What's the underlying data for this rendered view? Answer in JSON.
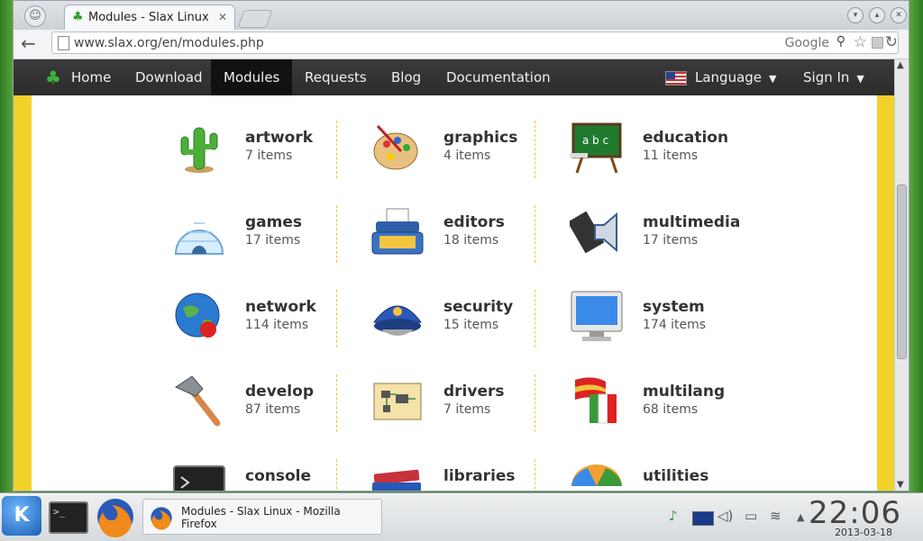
{
  "window": {
    "tab_title": "Modules - Slax Linux"
  },
  "toolbar": {
    "url": "www.slax.org/en/modules.php",
    "search_engine": "Google"
  },
  "nav": {
    "items": [
      "Home",
      "Download",
      "Modules",
      "Requests",
      "Blog",
      "Documentation"
    ],
    "active": "Modules",
    "language": "Language",
    "signin": "Sign In"
  },
  "categories": [
    {
      "name": "artwork",
      "count": "7 items",
      "icon": "cactus-icon"
    },
    {
      "name": "graphics",
      "count": "4 items",
      "icon": "palette-icon"
    },
    {
      "name": "education",
      "count": "11 items",
      "icon": "chalkboard-icon"
    },
    {
      "name": "games",
      "count": "17 items",
      "icon": "igloo-icon"
    },
    {
      "name": "editors",
      "count": "18 items",
      "icon": "typewriter-icon"
    },
    {
      "name": "multimedia",
      "count": "17 items",
      "icon": "speaker-clapper-icon"
    },
    {
      "name": "network",
      "count": "114 items",
      "icon": "globe-network-icon"
    },
    {
      "name": "security",
      "count": "15 items",
      "icon": "police-cap-icon"
    },
    {
      "name": "system",
      "count": "174 items",
      "icon": "monitor-icon"
    },
    {
      "name": "develop",
      "count": "87 items",
      "icon": "hammer-icon"
    },
    {
      "name": "drivers",
      "count": "7 items",
      "icon": "circuit-board-icon"
    },
    {
      "name": "multilang",
      "count": "68 items",
      "icon": "flags-icon"
    },
    {
      "name": "console",
      "count": "",
      "icon": "terminal-icon"
    },
    {
      "name": "libraries",
      "count": "",
      "icon": "books-icon"
    },
    {
      "name": "utilities",
      "count": "",
      "icon": "umbrella-icon"
    }
  ],
  "taskbar": {
    "task_label": "Modules - Slax Linux - Mozilla Firefox",
    "time": "22:06",
    "date": "2013-03-18"
  }
}
